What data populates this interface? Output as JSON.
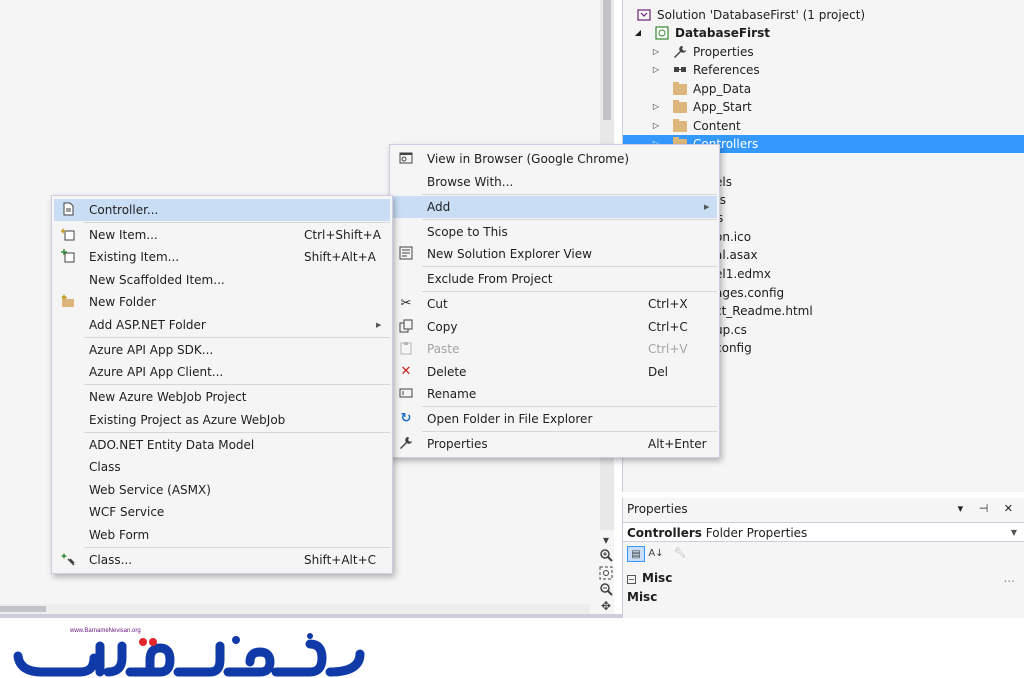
{
  "solution_explorer": {
    "items": [
      {
        "label": "Solution 'DatabaseFirst' (1 project)",
        "icon": "solution-icon"
      },
      {
        "label": "DatabaseFirst",
        "icon": "project-icon"
      },
      {
        "label": "Properties",
        "icon": "wrench-icon"
      },
      {
        "label": "References",
        "icon": "references-icon"
      },
      {
        "label": "App_Data",
        "icon": "folder-icon"
      },
      {
        "label": "App_Start",
        "icon": "folder-icon"
      },
      {
        "label": "Content",
        "icon": "folder-icon"
      },
      {
        "label": "Controllers",
        "icon": "folder-icon"
      }
    ],
    "partial_items": [
      "els",
      "ts",
      "s",
      "on.ico",
      "al.asax",
      "el1.edmx",
      "ages.config",
      "ct_Readme.html",
      "up.cs",
      "config"
    ]
  },
  "properties_panel": {
    "title": "Properties",
    "header_controls": "▾ ⊣ ✕",
    "object_name": "Controllers",
    "object_type": "Folder Properties",
    "section": "Misc",
    "section_dots": "...",
    "description_title": "Misc"
  },
  "context_menu": {
    "items": [
      {
        "label": "View in Browser (Google Chrome)",
        "shortcut": "",
        "icon": "browser-icon"
      },
      {
        "label": "Browse With...",
        "shortcut": "",
        "icon": ""
      },
      {
        "label": "Add",
        "shortcut": "",
        "icon": "",
        "submenu": true
      },
      {
        "label": "Scope to This",
        "shortcut": "",
        "icon": ""
      },
      {
        "label": "New Solution Explorer View",
        "shortcut": "",
        "icon": "new-view-icon"
      },
      {
        "label": "Exclude From Project",
        "shortcut": "",
        "icon": ""
      },
      {
        "label": "Cut",
        "shortcut": "Ctrl+X",
        "icon": "scissors-icon"
      },
      {
        "label": "Copy",
        "shortcut": "Ctrl+C",
        "icon": "copy-icon"
      },
      {
        "label": "Paste",
        "shortcut": "Ctrl+V",
        "icon": "paste-icon",
        "disabled": true
      },
      {
        "label": "Delete",
        "shortcut": "Del",
        "icon": "delete-icon"
      },
      {
        "label": "Rename",
        "shortcut": "",
        "icon": "rename-icon"
      },
      {
        "label": "Open Folder in File Explorer",
        "shortcut": "",
        "icon": "refresh-folder-icon"
      },
      {
        "label": "Properties",
        "shortcut": "Alt+Enter",
        "icon": "wrench-icon"
      }
    ]
  },
  "add_submenu": {
    "items": [
      {
        "label": "Controller...",
        "shortcut": "",
        "icon": "controller-icon"
      },
      {
        "label": "New Item...",
        "shortcut": "Ctrl+Shift+A",
        "icon": "new-item-icon"
      },
      {
        "label": "Existing Item...",
        "shortcut": "Shift+Alt+A",
        "icon": "existing-item-icon"
      },
      {
        "label": "New Scaffolded Item...",
        "shortcut": "",
        "icon": ""
      },
      {
        "label": "New Folder",
        "shortcut": "",
        "icon": "new-folder-icon"
      },
      {
        "label": "Add ASP.NET Folder",
        "shortcut": "",
        "icon": "",
        "submenu": true
      },
      {
        "label": "Azure API App SDK...",
        "shortcut": "",
        "icon": ""
      },
      {
        "label": "Azure API App Client...",
        "shortcut": "",
        "icon": ""
      },
      {
        "label": "New Azure WebJob Project",
        "shortcut": "",
        "icon": ""
      },
      {
        "label": "Existing Project as Azure WebJob",
        "shortcut": "",
        "icon": ""
      },
      {
        "label": "ADO.NET Entity Data Model",
        "shortcut": "",
        "icon": ""
      },
      {
        "label": "Class",
        "shortcut": "",
        "icon": ""
      },
      {
        "label": "Web Service (ASMX)",
        "shortcut": "",
        "icon": ""
      },
      {
        "label": "WCF Service",
        "shortcut": "",
        "icon": ""
      },
      {
        "label": "Web Form",
        "shortcut": "",
        "icon": ""
      },
      {
        "label": "Class...",
        "shortcut": "Shift+Alt+C",
        "icon": "class-wizard-icon"
      }
    ]
  },
  "logo": {
    "subtitle": "www.BarnameNevisan.org",
    "text": "برنامه نویسان",
    "color": "#0f3aa8",
    "accent": "#e3262b"
  }
}
